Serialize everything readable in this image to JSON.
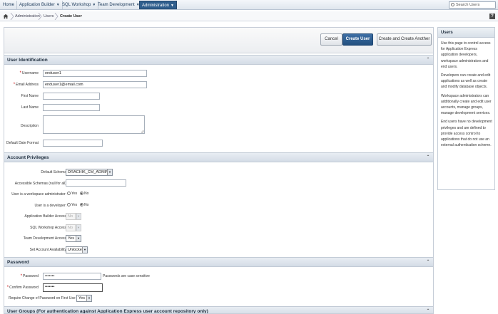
{
  "nav": {
    "tabs": [
      {
        "label": "Home",
        "chevron": false,
        "active": false
      },
      {
        "label": "Application Builder",
        "chevron": true,
        "active": false
      },
      {
        "label": "SQL Workshop",
        "chevron": true,
        "active": false
      },
      {
        "label": "Team Development",
        "chevron": true,
        "active": false
      },
      {
        "label": "Administration",
        "chevron": true,
        "active": true
      }
    ],
    "search_placeholder": "Search Users"
  },
  "breadcrumb": {
    "items": [
      "Administration",
      "Users"
    ],
    "current": "Create User"
  },
  "help_label": "?",
  "buttons": {
    "cancel": "Cancel",
    "create": "Create User",
    "create_another": "Create and Create Another"
  },
  "user_identification": {
    "title": "User Identification",
    "username_label": "Username",
    "username_value": "enduser1",
    "email_label": "Email Address",
    "email_value": "enduser1@email.com",
    "first_name_label": "First Name",
    "last_name_label": "Last Name",
    "description_label": "Description",
    "date_format_label": "Default Date Format"
  },
  "account_privileges": {
    "title": "Account Privileges",
    "default_schema_label": "Default Schema",
    "default_schema_value": "DRACHIK_CM_ADMIN",
    "accessible_schemas_label": "Accessible Schemas (null for all)",
    "workspace_admin_label": "User is a workspace administrator:",
    "developer_label": "User is a developer:",
    "yes": "Yes",
    "no": "No",
    "app_builder_label": "Application Builder Access",
    "app_builder_value": "No",
    "sql_workshop_label": "SQL Workshop Access",
    "sql_workshop_value": "No",
    "team_dev_label": "Team Development Access",
    "team_dev_value": "Yes",
    "availability_label": "Set Account Availability",
    "availability_value": "Unlocked"
  },
  "password": {
    "title": "Password",
    "password_label": "Password",
    "password_value": "•••••••",
    "case_note": "Passwords are case sensitive",
    "confirm_label": "Confirm Password",
    "confirm_value": "•••••••",
    "require_change_label": "Require Change of Password on First Use",
    "require_change_value": "Yes"
  },
  "user_groups": {
    "title": "User Groups (For authentication against Application Express user account repository only)"
  },
  "sidebar": {
    "title": "Users",
    "paragraphs": [
      "Use this page to control access for Application Express application developers, workspace administrators and end users.",
      "Developers can create and edit applications as well as create and modify database objects.",
      "Workspace administrators can additionally create and edit user accounts, manage groups, manage development services.",
      "End users have no development privileges and are defined to provide access control to applications that do not use an external authentication scheme."
    ]
  },
  "colors": {
    "active_tab": "#2f5e8d",
    "primary_button": "#2f5e8d",
    "required": "#cc0000"
  }
}
